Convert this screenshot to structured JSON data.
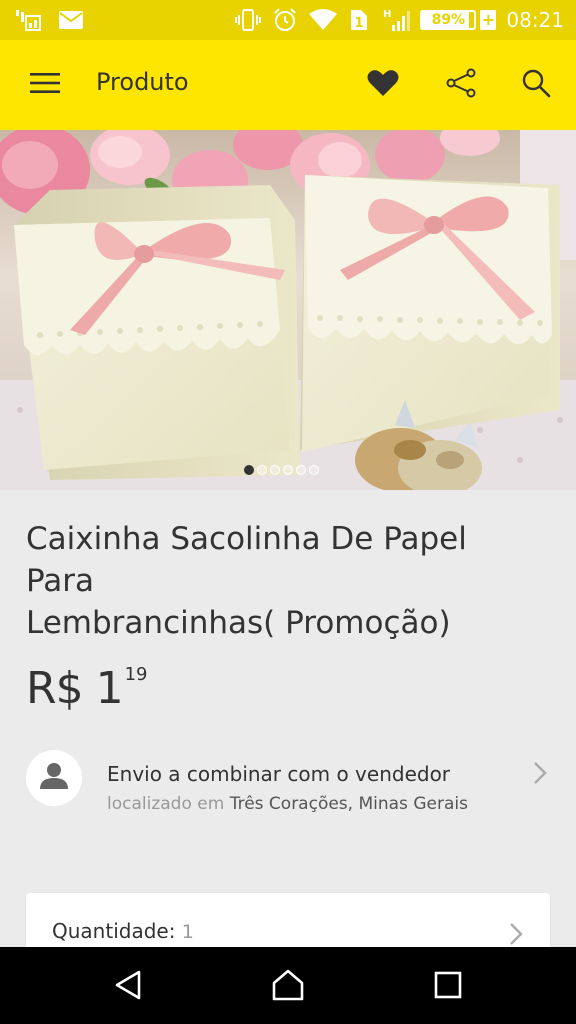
{
  "status_bar": {
    "battery": "89%",
    "battery_level": 0.89,
    "time": "08:21",
    "network_type": "H",
    "sim_slot": "1",
    "icons": [
      "signal-wifi-calling-icon",
      "mail-icon",
      "vibrate-icon",
      "alarm-icon",
      "wifi-icon",
      "sim-icon",
      "cell-signal-icon",
      "battery-icon",
      "charging-icon"
    ]
  },
  "app_bar": {
    "title": "Produto",
    "icons": [
      "hamburger-menu-icon",
      "heart-icon",
      "share-icon",
      "search-icon"
    ]
  },
  "gallery": {
    "image_count": 6,
    "active_index": 0
  },
  "product": {
    "title": "Caixinha Sacolinha De Papel\nPara\nLembrancinhas( Promoção)",
    "price": {
      "currency": "R$",
      "integer": "1",
      "cents": "19"
    }
  },
  "shipping": {
    "title": "Envio a combinar com o vendedor",
    "location_prefix": "localizado em",
    "location": "Três Corações, Minas Gerais"
  },
  "quantity": {
    "label": "Quantidade:",
    "value": "1"
  },
  "colors": {
    "app_bar": "#ffe600",
    "status_bar": "#e8d200",
    "background": "#ebebeb"
  }
}
